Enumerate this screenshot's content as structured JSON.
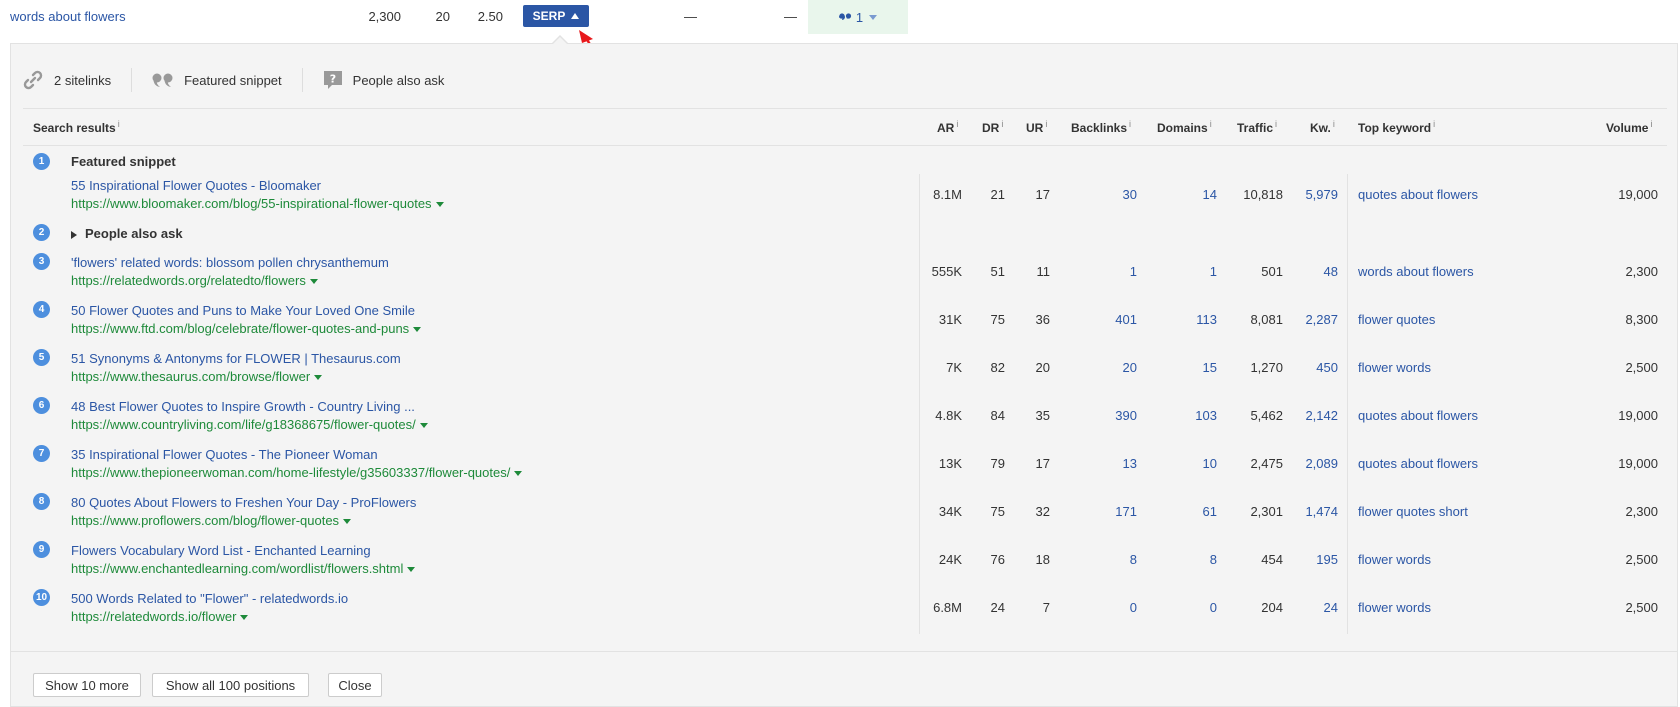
{
  "keyword_row": {
    "keyword": "words about flowers",
    "volume": "2,300",
    "kd": "20",
    "cpc": "2.50",
    "serp_label": "SERP",
    "dash1": "—",
    "dash2": "—",
    "serp_feature_count": "1"
  },
  "features": [
    {
      "icon": "link-icon",
      "label": "2 sitelinks"
    },
    {
      "icon": "quote-icon",
      "label": "Featured snippet"
    },
    {
      "icon": "question-icon",
      "label": "People also ask"
    }
  ],
  "headers": {
    "search_results": "Search results",
    "ar": "AR",
    "dr": "DR",
    "ur": "UR",
    "backlinks": "Backlinks",
    "domains": "Domains",
    "traffic": "Traffic",
    "kw": "Kw.",
    "top_keyword": "Top keyword",
    "volume": "Volume",
    "info": "i"
  },
  "sections": {
    "featured_snippet": "Featured snippet",
    "people_also_ask": "People also ask"
  },
  "results": [
    {
      "pos": "1",
      "title": "55 Inspirational Flower Quotes - Bloomaker",
      "url": "https://www.bloomaker.com/blog/55-inspirational-flower-quotes",
      "ar": "8.1M",
      "dr": "21",
      "ur": "17",
      "backlinks": "30",
      "domains": "14",
      "traffic": "10,818",
      "kw": "5,979",
      "top_keyword": "quotes about flowers",
      "volume": "19,000"
    },
    {
      "pos": "3",
      "title": "'flowers' related words: blossom pollen chrysanthemum",
      "url": "https://relatedwords.org/relatedto/flowers",
      "ar": "555K",
      "dr": "51",
      "ur": "11",
      "backlinks": "1",
      "domains": "1",
      "traffic": "501",
      "kw": "48",
      "top_keyword": "words about flowers",
      "volume": "2,300"
    },
    {
      "pos": "4",
      "title": "50 Flower Quotes and Puns to Make Your Loved One Smile",
      "url": "https://www.ftd.com/blog/celebrate/flower-quotes-and-puns",
      "ar": "31K",
      "dr": "75",
      "ur": "36",
      "backlinks": "401",
      "domains": "113",
      "traffic": "8,081",
      "kw": "2,287",
      "top_keyword": "flower quotes",
      "volume": "8,300"
    },
    {
      "pos": "5",
      "title": "51 Synonyms & Antonyms for FLOWER | Thesaurus.com",
      "url": "https://www.thesaurus.com/browse/flower",
      "ar": "7K",
      "dr": "82",
      "ur": "20",
      "backlinks": "20",
      "domains": "15",
      "traffic": "1,270",
      "kw": "450",
      "top_keyword": "flower words",
      "volume": "2,500"
    },
    {
      "pos": "6",
      "title": "48 Best Flower Quotes to Inspire Growth - Country Living ...",
      "url": "https://www.countryliving.com/life/g18368675/flower-quotes/",
      "ar": "4.8K",
      "dr": "84",
      "ur": "35",
      "backlinks": "390",
      "domains": "103",
      "traffic": "5,462",
      "kw": "2,142",
      "top_keyword": "quotes about flowers",
      "volume": "19,000"
    },
    {
      "pos": "7",
      "title": "35 Inspirational Flower Quotes - The Pioneer Woman",
      "url": "https://www.thepioneerwoman.com/home-lifestyle/g35603337/flower-quotes/",
      "ar": "13K",
      "dr": "79",
      "ur": "17",
      "backlinks": "13",
      "domains": "10",
      "traffic": "2,475",
      "kw": "2,089",
      "top_keyword": "quotes about flowers",
      "volume": "19,000"
    },
    {
      "pos": "8",
      "title": "80 Quotes About Flowers to Freshen Your Day - ProFlowers",
      "url": "https://www.proflowers.com/blog/flower-quotes",
      "ar": "34K",
      "dr": "75",
      "ur": "32",
      "backlinks": "171",
      "domains": "61",
      "traffic": "2,301",
      "kw": "1,474",
      "top_keyword": "flower quotes short",
      "volume": "2,300"
    },
    {
      "pos": "9",
      "title": "Flowers Vocabulary Word List - Enchanted Learning",
      "url": "https://www.enchantedlearning.com/wordlist/flowers.shtml",
      "ar": "24K",
      "dr": "76",
      "ur": "18",
      "backlinks": "8",
      "domains": "8",
      "traffic": "454",
      "kw": "195",
      "top_keyword": "flower words",
      "volume": "2,500"
    },
    {
      "pos": "10",
      "title": "500 Words Related to \"Flower\" - relatedwords.io",
      "url": "https://relatedwords.io/flower",
      "ar": "6.8M",
      "dr": "24",
      "ur": "7",
      "backlinks": "0",
      "domains": "0",
      "traffic": "204",
      "kw": "24",
      "top_keyword": "flower words",
      "volume": "2,500"
    }
  ],
  "buttons": {
    "show_more": "Show 10 more",
    "show_all": "Show all 100 positions",
    "close": "Close"
  },
  "colors": {
    "link": "#2b56a5",
    "url": "#1e8a3a",
    "badge": "#4d8fde",
    "serp_button": "#2b56a5",
    "panel_bg": "#f4f4f4",
    "serp_feature_bg": "#e9f6ec",
    "annotation_arrow": "#e8191c"
  }
}
